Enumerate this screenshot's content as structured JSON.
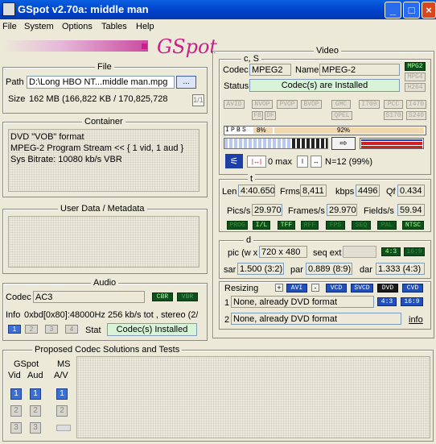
{
  "window": {
    "title": "GSpot v2.70a: middle man",
    "min": "_",
    "max": "□",
    "close": "×"
  },
  "menu": [
    "File",
    "System",
    "Options",
    "Tables",
    "Help"
  ],
  "logo": "GSpot",
  "file": {
    "title": "File",
    "path_label": "Path",
    "path": "D:\\Long HBO NT...middle man.mpg",
    "browse": "...",
    "size_label": "Size",
    "size": "162 MB (166,822 KB / 170,825,728",
    "page": "1/1"
  },
  "container": {
    "title": "Container",
    "lines": [
      "DVD \"VOB\" format",
      "MPEG-2 Program Stream << { 1 vid, 1 aud }",
      "Sys Bitrate: 10080 kb/s VBR"
    ]
  },
  "userdata": {
    "title": "User Data / Metadata"
  },
  "audio": {
    "title": "Audio",
    "codec_label": "Codec",
    "codec": "AC3",
    "cbr": "CBR",
    "vbr": "VBR",
    "info_label": "Info",
    "info": "0xbd[0x80]:48000Hz  256 kb/s tot , stereo (2/",
    "stat_label": "Stat",
    "stat": "Codec(s) Installed",
    "tabs": [
      "1",
      "2",
      "3",
      "4"
    ]
  },
  "codecs": {
    "title": "Proposed Codec Solutions and Tests",
    "gspot": "GSpot",
    "vid": "Vid",
    "aud": "Aud",
    "ms": "MS",
    "av": "A/V",
    "nums": [
      "1",
      "2",
      "3"
    ]
  },
  "video": {
    "title": "Video",
    "cs_title": "c, S",
    "codec_label": "Codec",
    "codec": "MPEG2",
    "name_label": "Name",
    "name": "MPEG-2",
    "status_label": "Status",
    "status": "Codec(s) are Installed",
    "tags_right": [
      "MPG2",
      "MPG4",
      "H264"
    ],
    "tags_row": [
      "AVID",
      "NVOP",
      "PVOP",
      "BVOP",
      "GMC",
      "I709",
      "PCC",
      "I470"
    ],
    "tags_row2": [
      "F8",
      "DF",
      "QPEL",
      "S170",
      "S240"
    ],
    "frame_types": [
      "I",
      "P",
      "B",
      "S"
    ],
    "pct1": "8%",
    "pct2": "92%",
    "max_label": "0 max",
    "n_label": "N=12 (99%)",
    "t_title": "t",
    "len_label": "Len",
    "len": "4:40.650",
    "frms_label": "Frms",
    "frms": "8,411",
    "kbps_label": "kbps",
    "kbps": "4496",
    "qf_label": "Qf",
    "qf": "0.434",
    "pics_label": "Pics/s",
    "pics": "29.970",
    "frames_label": "Frames/s",
    "frames": "29.970",
    "fields_label": "Fields/s",
    "fields": "59.94",
    "rate_tags": [
      "PROG",
      "I/L",
      "TFF",
      "RFF",
      "FPS",
      "SEQ",
      "PAL",
      "NTSC"
    ],
    "d_title": "d",
    "pic_label": "pic (w x",
    "pic": "720 x 480",
    "seqext_label": "seq ext",
    "ar43": "4:3",
    "ar169": "16:9",
    "sar_label": "sar",
    "sar": "1.500 (3:2)",
    "par_label": "par",
    "par": "0.889 (8:9)",
    "dar_label": "dar",
    "dar": "1.333 (4:3)",
    "resizing_label": "Resizing",
    "plus": "+",
    "avi": "AVI",
    "minus": "-",
    "vcd": "VCD",
    "svcd": "SVCD",
    "dvd": "DVD",
    "cvd": "CVD",
    "res1_num": "1",
    "res1": "None, already DVD format",
    "res1_ar": "4:3",
    "res1_ar2": "16:9",
    "res2_num": "2",
    "res2": "None, already DVD format",
    "info_link": "info"
  }
}
